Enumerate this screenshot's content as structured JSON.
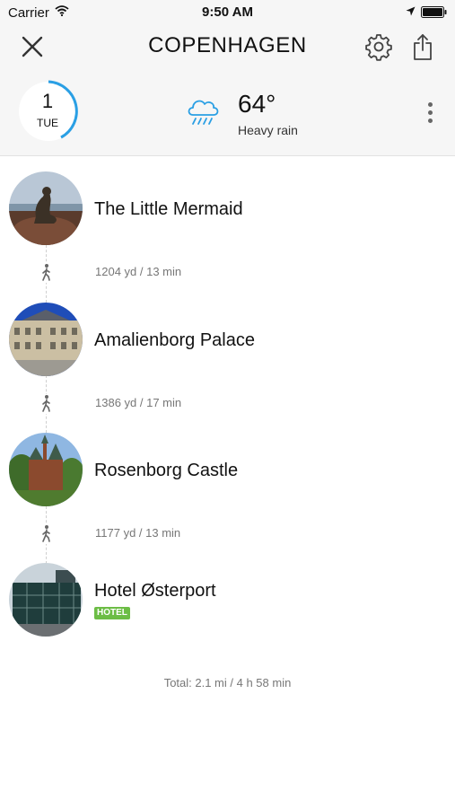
{
  "status_bar": {
    "carrier": "Carrier",
    "time": "9:50 AM"
  },
  "nav": {
    "title": "COPENHAGEN"
  },
  "day": {
    "number": "1",
    "weekday": "TUE"
  },
  "weather": {
    "temperature": "64°",
    "condition": "Heavy rain",
    "icon": "rain-cloud-icon"
  },
  "stops": [
    {
      "name": "The Little Mermaid"
    },
    {
      "name": "Amalienborg Palace"
    },
    {
      "name": "Rosenborg Castle"
    },
    {
      "name": "Hotel Østerport",
      "badge": "HOTEL"
    }
  ],
  "legs": [
    {
      "text": "1204 yd / 13 min"
    },
    {
      "text": "1386 yd / 17 min"
    },
    {
      "text": "1177 yd / 13 min"
    }
  ],
  "total": "Total: 2.1 mi / 4 h 58 min",
  "colors": {
    "accent": "#2a9fe4",
    "hotel_badge": "#6cbd45",
    "weather_icon": "#2a9fe4"
  }
}
